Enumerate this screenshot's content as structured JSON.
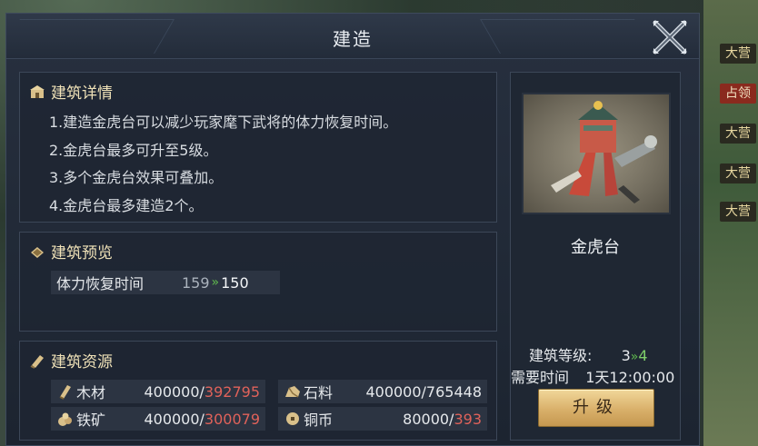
{
  "window": {
    "title": "建造"
  },
  "side_tags": [
    "大营",
    "占领",
    "大营",
    "大营",
    "大营"
  ],
  "details": {
    "heading": "建筑详情",
    "lines": [
      "1.建造金虎台可以减少玩家麾下武将的体力恢复时间。",
      "2.金虎台最多可升至5级。",
      "3.多个金虎台效果可叠加。",
      "4.金虎台最多建造2个。"
    ]
  },
  "preview": {
    "heading": "建筑预览",
    "row": {
      "label": "体力恢复时间",
      "from": "159",
      "arrow": "»",
      "to": "150"
    }
  },
  "resources": {
    "heading": "建筑资源",
    "items": [
      {
        "name": "木材",
        "required": "400000/",
        "have": "392795",
        "icon": "wood-icon"
      },
      {
        "name": "石料",
        "required": "400000/765448",
        "have": "",
        "icon": "stone-icon"
      },
      {
        "name": "铁矿",
        "required": "400000/",
        "have": "300079",
        "icon": "iron-icon"
      },
      {
        "name": "铜币",
        "required": "80000/",
        "have": "393",
        "icon": "copper-coin-icon"
      }
    ]
  },
  "building": {
    "name": "金虎台",
    "level_label": "建筑等级:",
    "level_from": "3",
    "level_arrow": "»",
    "level_to": "4",
    "time_label": "需要时间",
    "time_value": "1天12:00:00",
    "upgrade_label": "升级"
  },
  "colors": {
    "accent_gold": "#f0e2b8",
    "insufficient_red": "#e0625a",
    "increase_green": "#5fb84e"
  }
}
